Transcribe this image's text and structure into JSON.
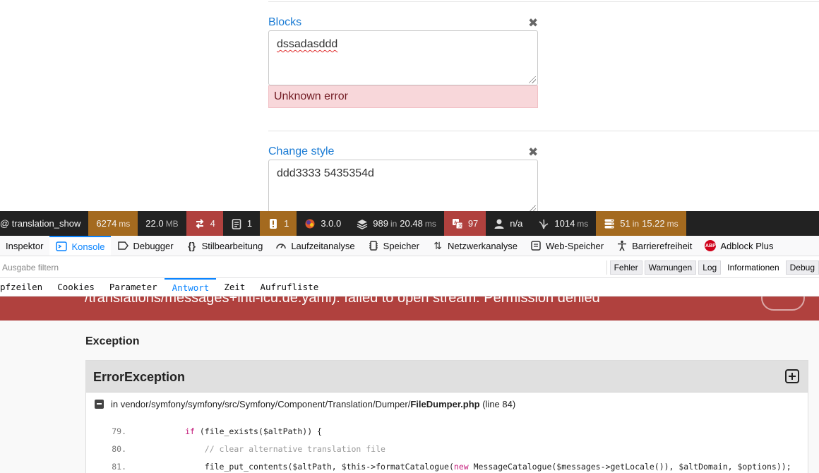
{
  "form": {
    "blocks_label": "Blocks",
    "blocks_value": "dssadasddd",
    "blocks_error": "Unknown error",
    "change_style_label": "Change style",
    "change_style_value": "ddd3333  5435354d",
    "close_glyph": "✖"
  },
  "toolbar": {
    "route": "@ translation_show",
    "time_value": "6274",
    "time_unit": "ms",
    "memory_value": "22.0",
    "memory_unit": "MB",
    "requests_count": "4",
    "forms_count": "1",
    "validator_count": "1",
    "version": "3.0.0",
    "cache_value": "989",
    "cache_in": "in",
    "cache_time": "20.48",
    "cache_unit": "ms",
    "translation_count": "97",
    "user_value": "n/a",
    "twig_value": "1014",
    "twig_unit": "ms",
    "db_value": "51",
    "db_in": "in",
    "db_time": "15.22",
    "db_unit": "ms"
  },
  "devtools": {
    "tabs": [
      "Inspektor",
      "Konsole",
      "Debugger",
      "Stilbearbeitung",
      "Laufzeitanalyse",
      "Speicher",
      "Netzwerkanalyse",
      "Web-Speicher",
      "Barrierefreiheit",
      "Adblock Plus"
    ],
    "active_tab": "Konsole",
    "filter_placeholder": "Ausgabe filtern",
    "filter_buttons": [
      "Fehler",
      "Warnungen",
      "Log",
      "Informationen",
      "Debug"
    ],
    "sub_tabs": [
      "pfzeilen",
      "Cookies",
      "Parameter",
      "Antwort",
      "Zeit",
      "Aufrufliste"
    ],
    "active_sub_tab": "Antwort"
  },
  "exception": {
    "message": "/translations/messages+intl-icu.de.yaml): failed to open stream: Permission denied",
    "section_title": "Exception",
    "class_name": "ErrorException",
    "path_prefix": "in vendor/symfony/symfony/src/Symfony/Component/Translation/Dumper/",
    "file_name": "FileDumper.php",
    "line_info": "(line 84)",
    "code_lines": [
      {
        "num": "79.",
        "indent": "            ",
        "kw1": "if",
        "rest": " (file_exists($altPath)) {"
      },
      {
        "num": "80.",
        "indent": "                ",
        "comment": "// clear alternative translation file"
      },
      {
        "num": "81.",
        "indent": "                ",
        "pre": "file_put_contents($altPath, $this->formatCatalogue(",
        "kw1": "new",
        "rest": " MessageCatalogue($messages->getLocale()), $altDomain, $options));"
      }
    ]
  }
}
